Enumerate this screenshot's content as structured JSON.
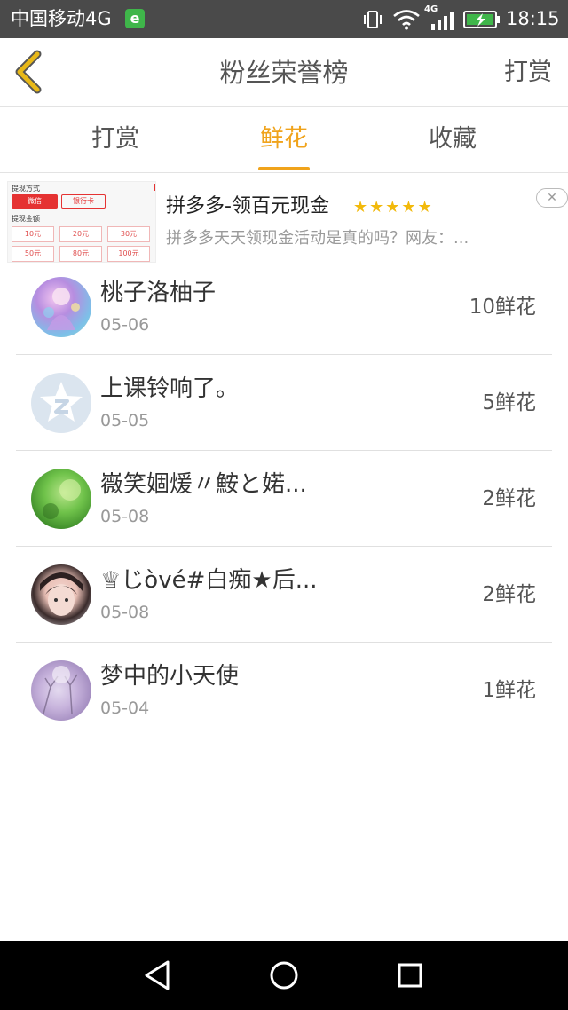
{
  "status_bar": {
    "carrier": "中国移动4G",
    "app_badge": "e",
    "network_label": "4G",
    "time": "18:15"
  },
  "header": {
    "title": "粉丝荣誉榜",
    "action_label": "打赏"
  },
  "tabs": [
    {
      "label": "打赏",
      "active": false
    },
    {
      "label": "鲜花",
      "active": true
    },
    {
      "label": "收藏",
      "active": false
    }
  ],
  "ad": {
    "title": "拼多多-领百元现金",
    "stars": "★★★★★",
    "description": "拼多多天天领现金活动是真的吗？网友：...",
    "close_label": "✕",
    "thumb": {
      "heading": "提现方式",
      "option_wechat": "微信",
      "option_card": "银行卡",
      "amount_heading": "提现金额",
      "amounts": [
        "10元",
        "20元",
        "30元",
        "50元",
        "80元",
        "100元"
      ]
    }
  },
  "fans": [
    {
      "name": "桃子洛柚子",
      "date": "05-06",
      "count": "10鲜花"
    },
    {
      "name": "上课铃响了。",
      "date": "05-05",
      "count": "5鲜花"
    },
    {
      "name": "嶶笑婟煖〃鮟と婼...",
      "date": "05-08",
      "count": "2鲜花"
    },
    {
      "name": "♕じòvé#白痴★后...",
      "date": "05-08",
      "count": "2鲜花"
    },
    {
      "name": "梦中的小天使",
      "date": "05-04",
      "count": "1鲜花"
    }
  ],
  "colors": {
    "accent": "#f0a31b",
    "back_arrow": "#e8b818",
    "star": "#f2b90b",
    "status_bar": "#4a4a4a"
  },
  "icons": {
    "back": "chevron-left-icon",
    "nav_back": "triangle-back-icon",
    "nav_home": "circle-home-icon",
    "nav_recent": "square-recent-icon"
  }
}
